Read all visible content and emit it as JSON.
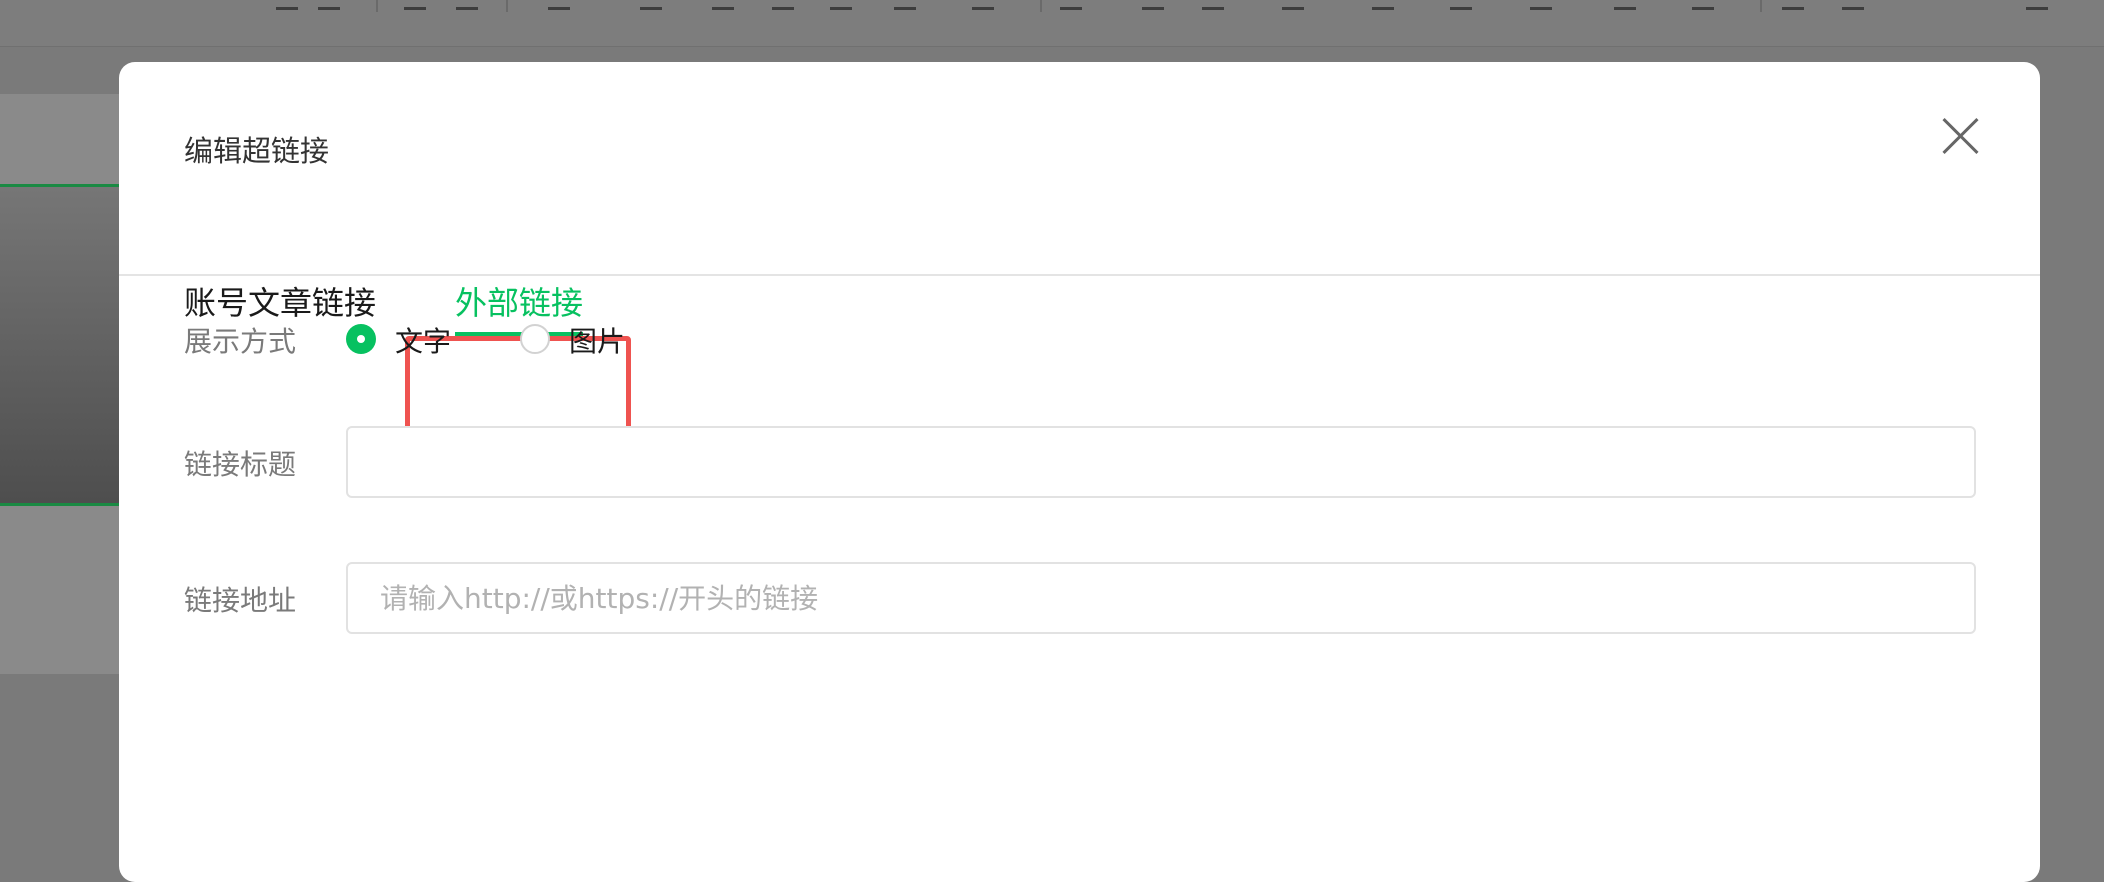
{
  "dialog": {
    "title": "编辑超链接",
    "tabs": [
      {
        "label": "账号文章链接",
        "active": false
      },
      {
        "label": "外部链接",
        "active": true
      }
    ],
    "display_mode": {
      "label": "展示方式",
      "options": [
        {
          "label": "文字",
          "checked": true
        },
        {
          "label": "图片",
          "checked": false
        }
      ]
    },
    "link_title": {
      "label": "链接标题",
      "value": "",
      "placeholder": ""
    },
    "link_url": {
      "label": "链接地址",
      "value": "",
      "placeholder": "请输入http://或https://开头的链接"
    }
  },
  "colors": {
    "accent": "#07c160",
    "highlight": "#ef5350",
    "overlay": "#7a7a7a"
  },
  "icons": {
    "close": "close-icon"
  }
}
